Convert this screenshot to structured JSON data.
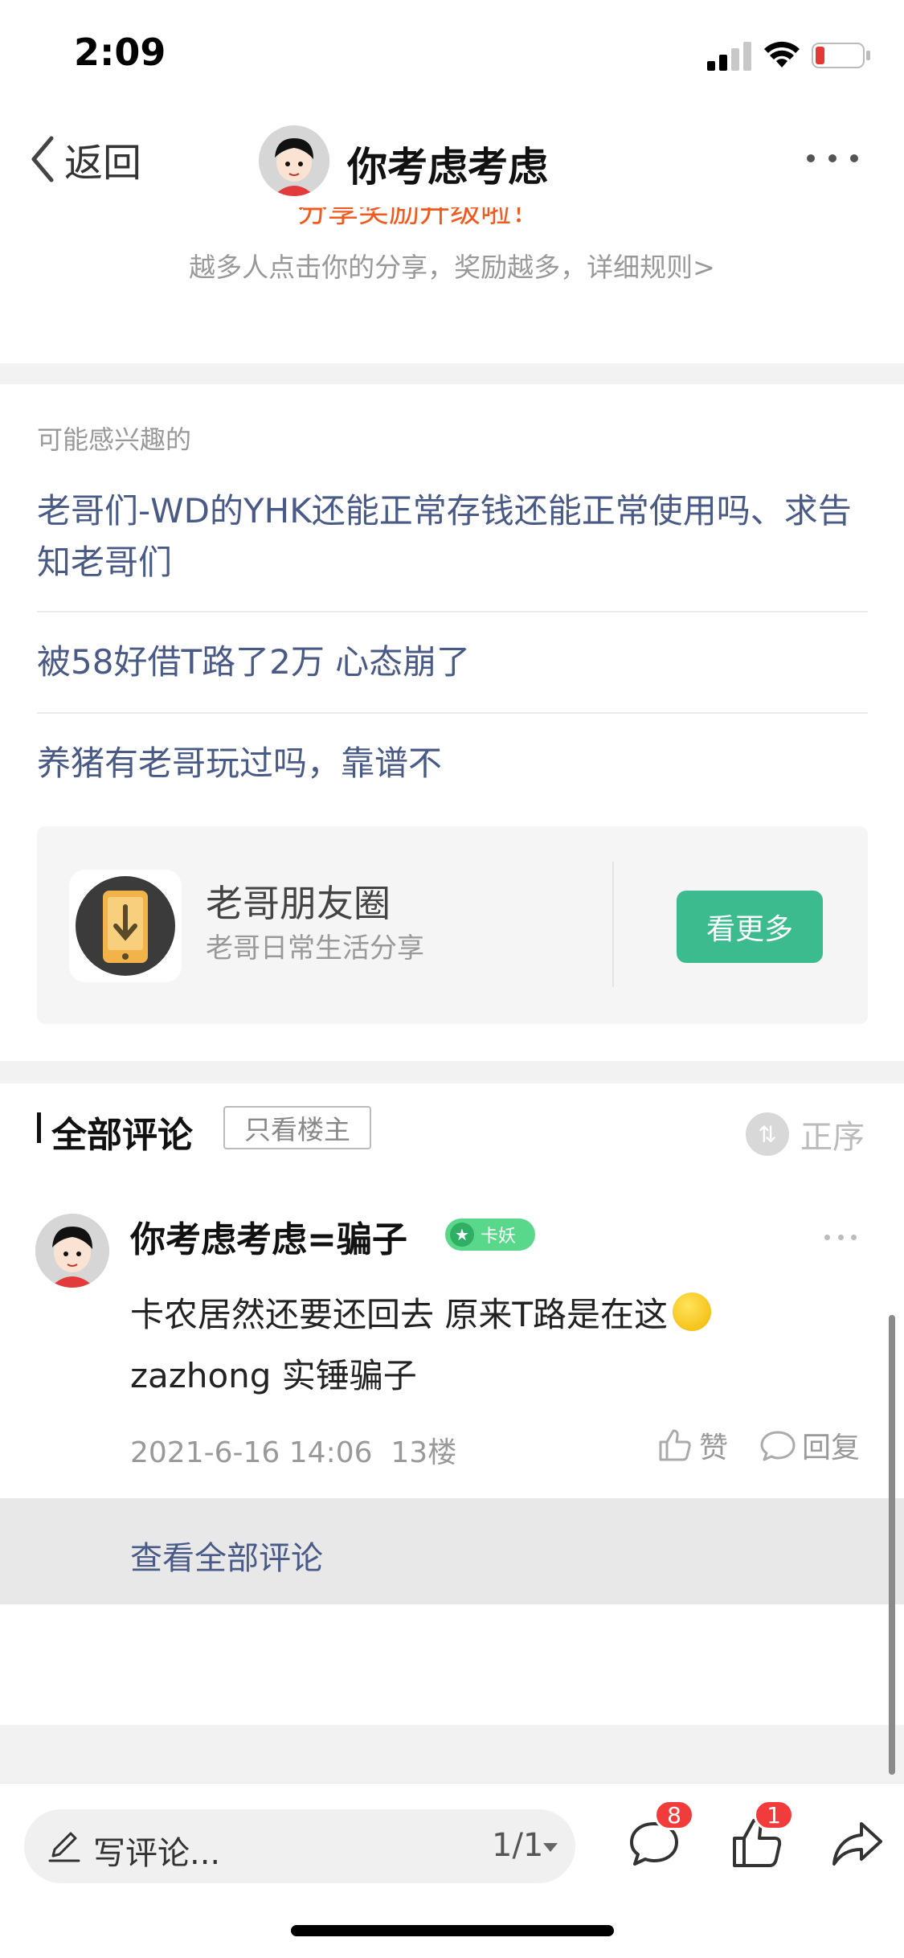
{
  "status_bar": {
    "time": "2:09",
    "battery_color": "#e53935"
  },
  "nav": {
    "back_label": "返回",
    "title": "你考虑考虑"
  },
  "share": {
    "clipped_title": "分享奖励升级啦！",
    "subtitle": "越多人点击你的分享，奖励越多，详细规则>"
  },
  "related": {
    "section_label": "可能感兴趣的",
    "topics": [
      "老哥们-WD的YHK还能正常存钱还能正常使用吗、求告知老哥们",
      "被58好借T路了2万 心态崩了",
      "养猪有老哥玩过吗，靠谱不"
    ]
  },
  "promo": {
    "title": "老哥朋友圈",
    "subtitle": "老哥日常生活分享",
    "button": "看更多",
    "accent": "#3cbb8f"
  },
  "comments": {
    "title": "全部评论",
    "filter": "只看楼主",
    "sort": "正序",
    "items": [
      {
        "user": "你考虑考虑=骗子",
        "badge": "卡妖",
        "text_before_emoji": "卡农居然还要还回去  原来T路是在这",
        "text_after_emoji": "  zazhong  实锤骗子",
        "date": "2021-6-16 14:06",
        "floor": "13楼",
        "like_label": "赞",
        "reply_label": "回复"
      }
    ],
    "view_all": "查看全部评论"
  },
  "bottom_bar": {
    "placeholder": "写评论...",
    "page": "1/1",
    "comment_count": "8",
    "like_count": "1"
  },
  "colors": {
    "link": "#4a5a87",
    "badge_red": "#f23b3b"
  },
  "icons": [
    "back-chevron-icon",
    "more-icon",
    "pencil-icon",
    "comment-bubble-icon",
    "thumb-up-icon",
    "share-arrow-icon",
    "sort-icon",
    "star-icon"
  ]
}
